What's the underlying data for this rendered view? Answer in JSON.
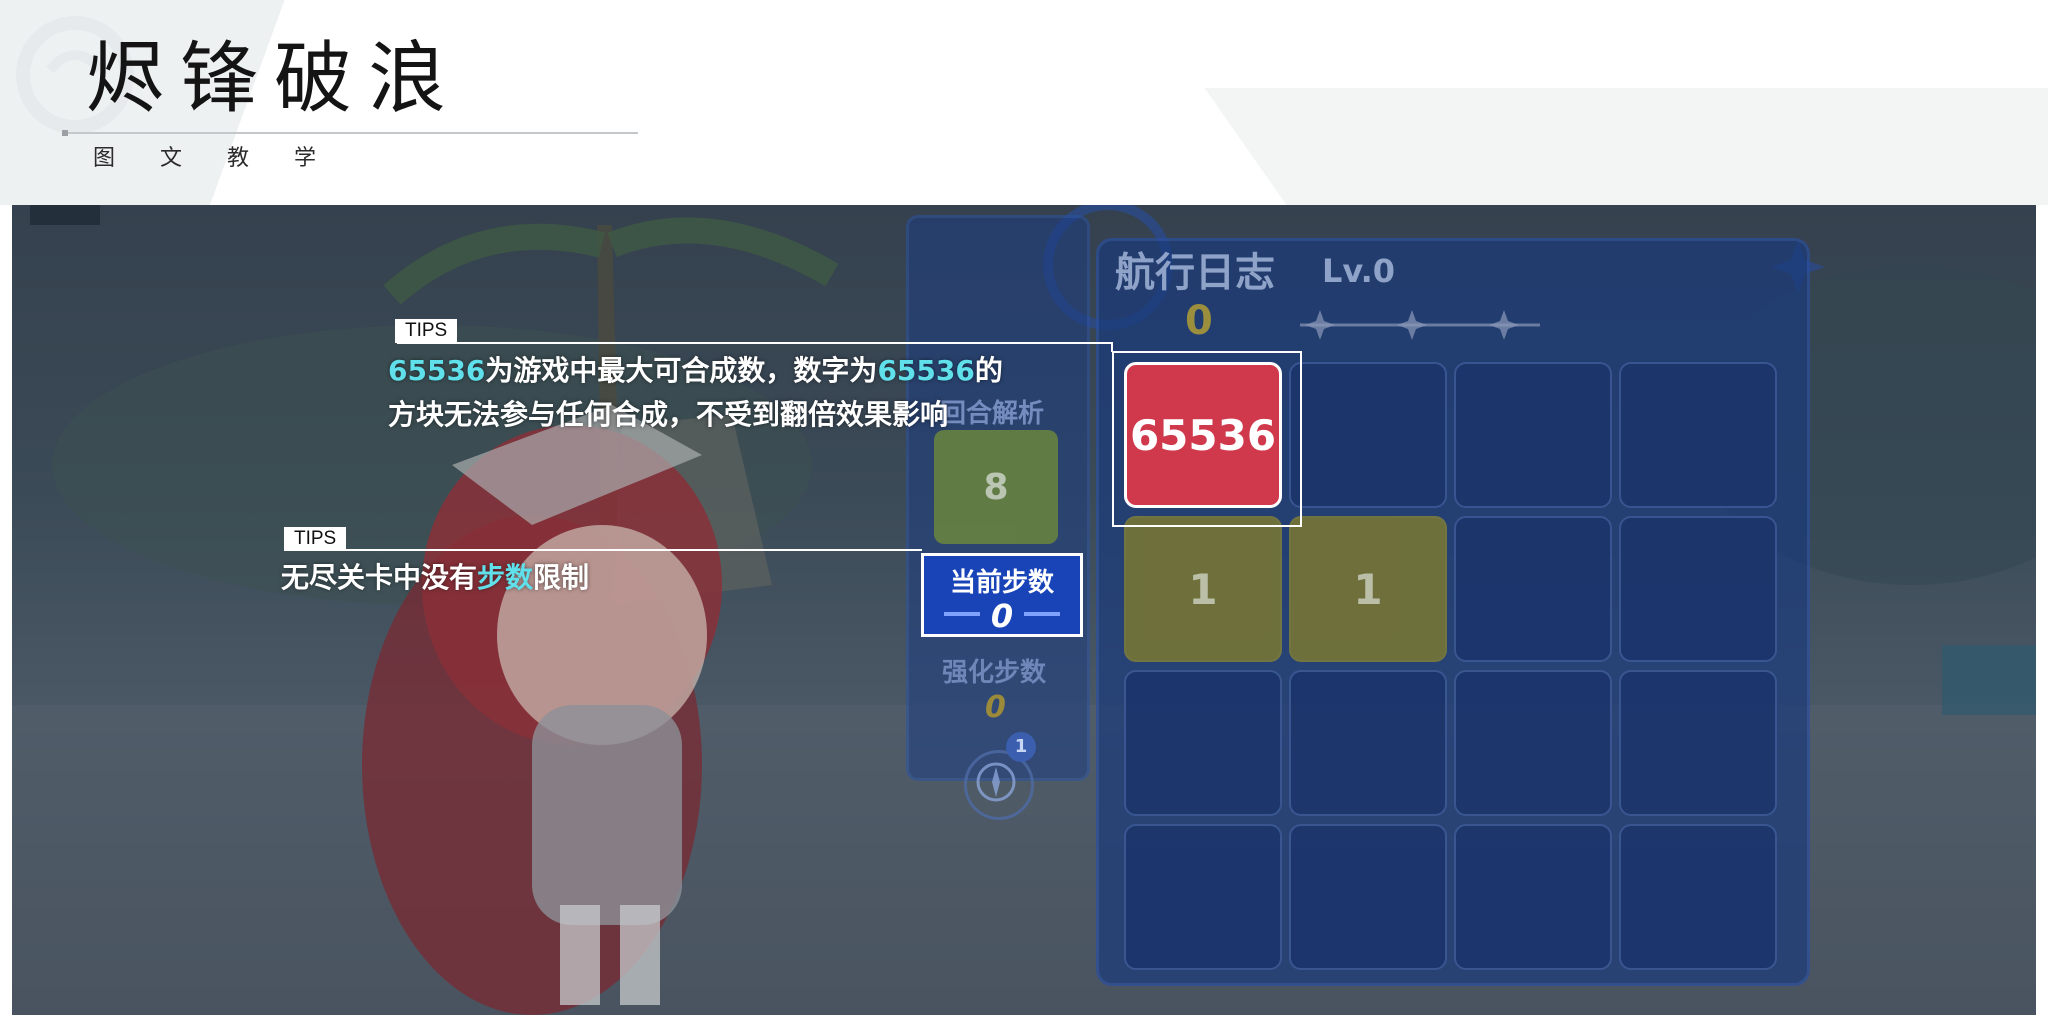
{
  "header": {
    "title": "烬锋破浪",
    "subtitle": "图 文 教 学"
  },
  "game": {
    "board_title": "航行日志",
    "board_level": "Lv.0",
    "score": "0",
    "analysis_label": "回合解析",
    "green_tile_value": "8",
    "current_steps_label": "当前步数",
    "current_steps_value": "0",
    "strengthen_steps_label": "强化步数",
    "strengthen_steps_value": "0",
    "compass_badge": "1",
    "tiles": {
      "max_tile": "65536",
      "tile_r2c1": "1",
      "tile_r2c2": "1"
    }
  },
  "tips": [
    {
      "label": "TIPS",
      "line1_hl1": "65536",
      "line1_mid": "为游戏中最大可合成数，数字为",
      "line1_hl2": "65536",
      "line1_end": "的",
      "line2": "方块无法参与任何合成，不受到翻倍效果影响"
    },
    {
      "label": "TIPS",
      "pre": "无尽关卡中没有",
      "hl": "步数",
      "post": "限制"
    }
  ],
  "colors": {
    "highlight": "#5fe0ea",
    "tile_red": "#d0384c",
    "steps_blue": "#1844b8"
  }
}
